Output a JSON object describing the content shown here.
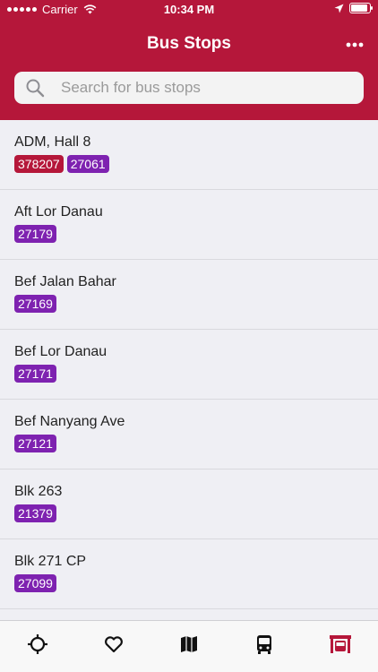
{
  "status_bar": {
    "carrier": "Carrier",
    "time": "10:34 PM"
  },
  "header": {
    "title": "Bus Stops",
    "more_icon": "ellipsis-icon"
  },
  "search": {
    "placeholder": "Search for bus stops",
    "value": ""
  },
  "colors": {
    "brand": "#b5173a",
    "badge_red": "#b5173a",
    "badge_purple": "#7e22b0",
    "tab_active": "#b5173a",
    "tab_inactive": "#111111"
  },
  "stops": [
    {
      "name": "ADM, Hall 8",
      "codes": [
        {
          "code": "378207",
          "color": "red"
        },
        {
          "code": "27061",
          "color": "purple"
        }
      ]
    },
    {
      "name": "Aft Lor Danau",
      "codes": [
        {
          "code": "27179",
          "color": "purple"
        }
      ]
    },
    {
      "name": "Bef Jalan Bahar",
      "codes": [
        {
          "code": "27169",
          "color": "purple"
        }
      ]
    },
    {
      "name": "Bef Lor Danau",
      "codes": [
        {
          "code": "27171",
          "color": "purple"
        }
      ]
    },
    {
      "name": "Bef Nanyang Ave",
      "codes": [
        {
          "code": "27121",
          "color": "purple"
        }
      ]
    },
    {
      "name": "Blk 263",
      "codes": [
        {
          "code": "21379",
          "color": "purple"
        }
      ]
    },
    {
      "name": "Blk 271 CP",
      "codes": [
        {
          "code": "27099",
          "color": "purple"
        }
      ]
    }
  ],
  "tabs": [
    {
      "icon": "crosshair-icon",
      "active": false
    },
    {
      "icon": "heart-icon",
      "active": false
    },
    {
      "icon": "map-icon",
      "active": false
    },
    {
      "icon": "bus-icon",
      "active": false
    },
    {
      "icon": "bus-stop-icon",
      "active": true
    }
  ]
}
